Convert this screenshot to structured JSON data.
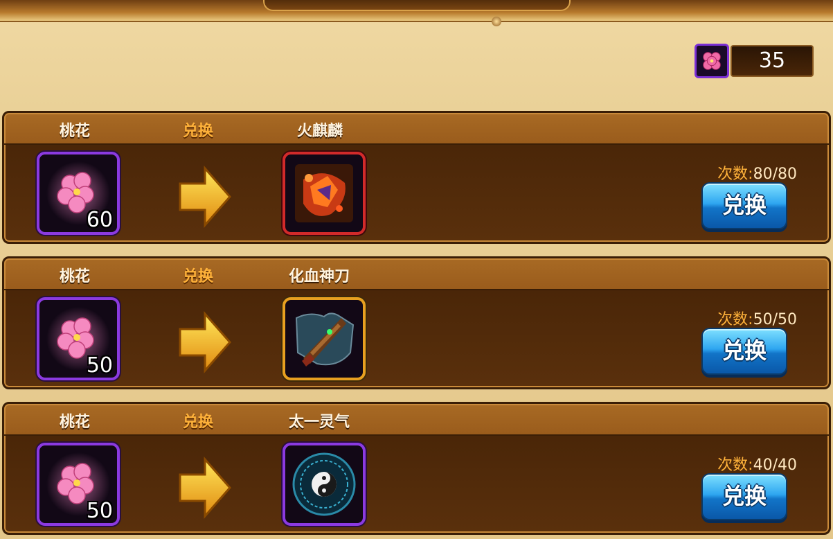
{
  "currency": {
    "icon": "peach-blossom-icon",
    "value": "35"
  },
  "exchange_rows": [
    {
      "cost_label": "桃花",
      "exchange_label": "兑换",
      "reward_name": "火麒麟",
      "cost_icon": "peach-blossom-icon",
      "cost_amount": "60",
      "reward_icon": "fire-qilin-fragment-icon",
      "count_label": "次数:",
      "count_value": "80/80",
      "button_label": "兑换"
    },
    {
      "cost_label": "桃花",
      "exchange_label": "兑换",
      "reward_name": "化血神刀",
      "cost_icon": "peach-blossom-icon",
      "cost_amount": "50",
      "reward_icon": "blood-blade-fragment-icon",
      "count_label": "次数:",
      "count_value": "50/50",
      "button_label": "兑换"
    },
    {
      "cost_label": "桃花",
      "exchange_label": "兑换",
      "reward_name": "太一灵气",
      "cost_icon": "peach-blossom-icon",
      "cost_amount": "50",
      "reward_icon": "taiji-spirit-icon",
      "count_label": "次数:",
      "count_value": "40/40",
      "button_label": "兑换"
    }
  ],
  "colors": {
    "row_header": "#9a5c1c",
    "row_body": "#4a2608",
    "exchange_text": "#ffb23a",
    "button_blue": "#1e8fe0",
    "currency_border": "#7b2fd6"
  }
}
